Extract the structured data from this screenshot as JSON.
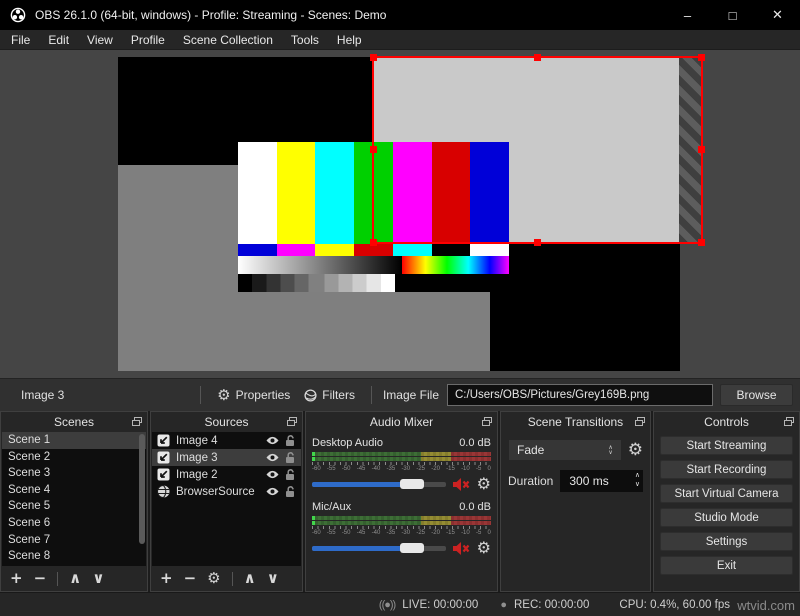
{
  "window": {
    "title": "OBS 26.1.0 (64-bit, windows) - Profile: Streaming - Scenes: Demo",
    "minimize": "–",
    "maximize": "□",
    "close": "✕"
  },
  "menu": {
    "items": [
      "File",
      "Edit",
      "View",
      "Profile",
      "Scene Collection",
      "Tools",
      "Help"
    ]
  },
  "preview": {
    "selection_color": "#ff0000",
    "canvas_bg": "#000000",
    "grey_rect_color": "#7f7f7f",
    "light_rect_color": "#c9c9c9",
    "color_bars": [
      "#ffffff",
      "#ffff00",
      "#00ffff",
      "#00d000",
      "#ff00ff",
      "#d80000",
      "#0000d8"
    ],
    "small_bars": [
      "#0000d8",
      "#ff00ff",
      "#ffff00",
      "#d80000",
      "#00ffff",
      "#000000",
      "#ffffff"
    ]
  },
  "source_toolbar": {
    "selected_source": "Image 3",
    "properties": "Properties",
    "filters": "Filters",
    "image_file_label": "Image File",
    "image_file_value": "C:/Users/OBS/Pictures/Grey169B.png",
    "browse": "Browse"
  },
  "docks": {
    "scenes": {
      "title": "Scenes",
      "items": [
        "Scene 1",
        "Scene 2",
        "Scene 3",
        "Scene 4",
        "Scene 5",
        "Scene 6",
        "Scene 7",
        "Scene 8"
      ],
      "selected": "Scene 1"
    },
    "sources": {
      "title": "Sources",
      "items": [
        "Image 4",
        "Image 3",
        "Image 2",
        "BrowserSource"
      ],
      "selected": "Image 3"
    },
    "audio_mixer": {
      "title": "Audio Mixer",
      "channels": [
        {
          "name": "Desktop Audio",
          "level": "0.0 dB",
          "muted": true
        },
        {
          "name": "Mic/Aux",
          "level": "0.0 dB",
          "muted": true
        }
      ],
      "scale": [
        "-60",
        "-55",
        "-50",
        "-45",
        "-40",
        "-35",
        "-30",
        "-25",
        "-20",
        "-15",
        "-10",
        "-5",
        "0"
      ]
    },
    "scene_transitions": {
      "title": "Scene Transitions",
      "transition": "Fade",
      "duration_label": "Duration",
      "duration_value": "300 ms"
    },
    "controls": {
      "title": "Controls",
      "buttons": [
        "Start Streaming",
        "Start Recording",
        "Start Virtual Camera",
        "Studio Mode",
        "Settings",
        "Exit"
      ]
    }
  },
  "status": {
    "live": "LIVE: 00:00:00",
    "rec": "REC: 00:00:00",
    "cpu": "CPU: 0.4%, 60.00 fps"
  },
  "watermark": "wtvid.com",
  "icons": {
    "plus": "+",
    "minus": "−",
    "up": "∧",
    "down": "∨",
    "gear": "⚙",
    "mute_x": "✕",
    "combo_up": "∧",
    "combo_down": "∨"
  },
  "colors": {
    "slider_fill": "#2e6bc9",
    "mute_red": "#cc2222",
    "meter_green": "#3d6e36",
    "meter_yellow": "#948c33",
    "meter_red": "#993636"
  }
}
